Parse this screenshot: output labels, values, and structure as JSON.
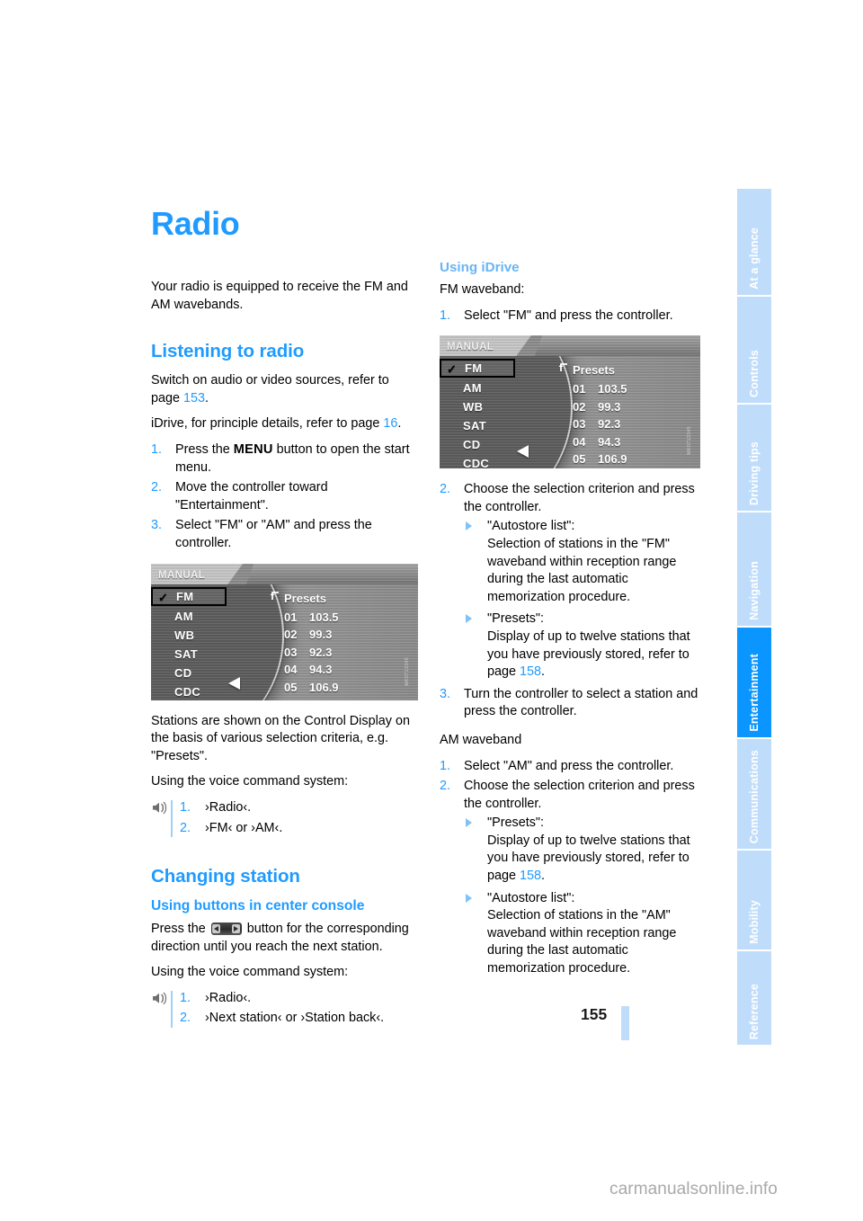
{
  "document": {
    "page_number": "155",
    "watermark": "carmanualsonline.info"
  },
  "sidebar": {
    "tabs": [
      {
        "label": "At a glance",
        "active": false
      },
      {
        "label": "Controls",
        "active": false
      },
      {
        "label": "Driving tips",
        "active": false
      },
      {
        "label": "Navigation",
        "active": false
      },
      {
        "label": "Entertainment",
        "active": true
      },
      {
        "label": "Communications",
        "active": false
      },
      {
        "label": "Mobility",
        "active": false
      },
      {
        "label": "Reference",
        "active": false
      }
    ],
    "colors": {
      "inactive": "#bfddfb",
      "active": "#0a95ff",
      "text": "#ffffff"
    }
  },
  "left_column": {
    "title": "Radio",
    "intro": "Your radio is equipped to receive the FM and AM wavebands.",
    "section_listening": {
      "heading": "Listening to radio",
      "para_1_a": "Switch on audio or video sources, refer to page ",
      "para_1_link": "153",
      "para_1_b": ".",
      "para_2_a": "iDrive, for principle details, refer to page ",
      "para_2_link": "16",
      "para_2_b": ".",
      "steps": [
        {
          "num": "1.",
          "text_a": "Press the ",
          "kbd": "MENU",
          "text_b": " button to open the start menu."
        },
        {
          "num": "2.",
          "text_a": "Move the controller toward \"Entertainment\".",
          "kbd": "",
          "text_b": ""
        },
        {
          "num": "3.",
          "text_a": "Select \"FM\" or \"AM\" and press the controller.",
          "kbd": "",
          "text_b": ""
        }
      ],
      "after_figure_1": "Stations are shown on the Control Display on the basis of various selection criteria, e.g. \"Presets\".",
      "voice_intro": "Using the voice command system:",
      "voice_steps": [
        {
          "num": "1.",
          "text": "›Radio‹."
        },
        {
          "num": "2.",
          "text": "›FM‹ or ›AM‹."
        }
      ]
    },
    "section_changing": {
      "heading": "Changing station",
      "subheading": "Using buttons in center console",
      "para_a": "Press the ",
      "para_b": " button for the corresponding direction until you reach the next station.",
      "voice_intro": "Using the voice command system:",
      "voice_steps": [
        {
          "num": "1.",
          "text": "›Radio‹."
        },
        {
          "num": "2.",
          "text": "›Next station‹ or ›Station back‹."
        }
      ]
    }
  },
  "right_column": {
    "section_idrive": {
      "heading": "Using iDrive",
      "fm_label": "FM waveband:",
      "fm_step_1": {
        "num": "1.",
        "text": "Select \"FM\" and press the controller."
      },
      "fm_step_2": {
        "num": "2.",
        "text": "Choose the selection criterion and press the controller."
      },
      "fm_bullets": [
        {
          "title": "\"Autostore list\":",
          "body": "Selection of stations in the \"FM\" waveband within reception range during the last automatic memorization procedure."
        },
        {
          "title": "\"Presets\":",
          "body_a": "Display of up to twelve stations that you have previously stored, refer to page ",
          "link": "158",
          "body_b": "."
        }
      ],
      "fm_step_3": {
        "num": "3.",
        "text": "Turn the controller to select a station and press the controller."
      },
      "am_label": "AM waveband",
      "am_step_1": {
        "num": "1.",
        "text": "Select \"AM\" and press the controller."
      },
      "am_step_2": {
        "num": "2.",
        "text": "Choose the selection criterion and press the controller."
      },
      "am_bullets": [
        {
          "title": "\"Presets\":",
          "body_a": "Display of up to twelve stations that you have previously stored, refer to page ",
          "link": "158",
          "body_b": "."
        },
        {
          "title": "\"Autostore list\":",
          "body": "Selection of stations in the \"AM\" waveband within reception range during the last automatic memorization procedure."
        }
      ]
    }
  },
  "idrive_figure": {
    "header_label": "MANUAL",
    "menu_items": [
      {
        "label": "FM",
        "selected": true,
        "checked": true
      },
      {
        "label": "AM",
        "selected": false,
        "checked": false
      },
      {
        "label": "WB",
        "selected": false,
        "checked": false
      },
      {
        "label": "SAT",
        "selected": false,
        "checked": false
      },
      {
        "label": "CD",
        "selected": false,
        "checked": false
      },
      {
        "label": "CDC",
        "selected": false,
        "checked": false
      }
    ],
    "presets_title": "Presets",
    "presets": [
      {
        "no": "01",
        "freq": "103.5"
      },
      {
        "no": "02",
        "freq": "99.3"
      },
      {
        "no": "03",
        "freq": "92.3"
      },
      {
        "no": "04",
        "freq": "94.3"
      },
      {
        "no": "05",
        "freq": "106.9"
      }
    ],
    "fig_code": "MK0713345"
  },
  "colors": {
    "heading_blue": "#1f9bff",
    "subheading_blue": "#69b4f5",
    "link_blue": "#1f9bff",
    "tab_inactive": "#bfddfb",
    "tab_active": "#0a95ff",
    "body_text": "#000000"
  }
}
